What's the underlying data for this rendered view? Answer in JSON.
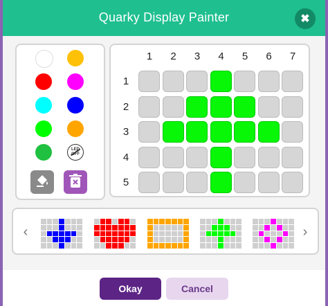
{
  "header": {
    "title": "Quarky Display Painter",
    "close_icon": "close-icon"
  },
  "palette": {
    "colors": [
      "#ffffff",
      "#ffc107",
      "#ff0000",
      "#ff00ff",
      "#00ffff",
      "#0000ff",
      "#00ff00",
      "#ffa500",
      "#20c040"
    ],
    "led_off_label": [
      "LED",
      "OFF"
    ],
    "tools": [
      {
        "icon": "fill-bucket-icon",
        "color": "#8a8a8a"
      },
      {
        "icon": "trash-icon",
        "color": "#a056b8"
      }
    ]
  },
  "grid": {
    "columns": [
      "1",
      "2",
      "3",
      "4",
      "5",
      "6",
      "7"
    ],
    "rows": [
      "1",
      "2",
      "3",
      "4",
      "5"
    ],
    "on_color": "#07f707",
    "off_color": "#d6d6d6",
    "cells": [
      [
        0,
        0,
        0,
        1,
        0,
        0,
        0
      ],
      [
        0,
        0,
        1,
        1,
        1,
        0,
        0
      ],
      [
        0,
        1,
        1,
        1,
        1,
        1,
        0
      ],
      [
        0,
        0,
        0,
        1,
        0,
        0,
        0
      ],
      [
        0,
        0,
        0,
        1,
        0,
        0,
        0
      ]
    ]
  },
  "presets": {
    "left_arrow": "‹",
    "right_arrow": "›",
    "items": [
      {
        "name": "blue-down-arrow",
        "color": "#0000ff",
        "cells": [
          [
            0,
            0,
            0,
            1,
            0,
            0,
            0
          ],
          [
            0,
            0,
            0,
            1,
            0,
            0,
            0
          ],
          [
            0,
            1,
            1,
            1,
            1,
            1,
            0
          ],
          [
            0,
            0,
            1,
            1,
            1,
            0,
            0
          ],
          [
            0,
            0,
            0,
            1,
            0,
            0,
            0
          ]
        ]
      },
      {
        "name": "red-heart",
        "color": "#ff0000",
        "cells": [
          [
            0,
            1,
            1,
            0,
            1,
            1,
            0
          ],
          [
            1,
            1,
            1,
            1,
            1,
            1,
            1
          ],
          [
            1,
            1,
            1,
            1,
            1,
            1,
            1
          ],
          [
            0,
            1,
            1,
            1,
            1,
            1,
            0
          ],
          [
            0,
            0,
            1,
            1,
            1,
            0,
            0
          ]
        ]
      },
      {
        "name": "orange-frame",
        "color": "#ffa500",
        "cells": [
          [
            1,
            1,
            1,
            1,
            1,
            1,
            1
          ],
          [
            1,
            0,
            0,
            0,
            0,
            0,
            1
          ],
          [
            1,
            0,
            0,
            0,
            0,
            0,
            1
          ],
          [
            1,
            0,
            0,
            0,
            0,
            0,
            1
          ],
          [
            1,
            1,
            1,
            1,
            1,
            1,
            1
          ]
        ]
      },
      {
        "name": "green-up-arrow",
        "color": "#00ff00",
        "cells": [
          [
            0,
            0,
            0,
            1,
            0,
            0,
            0
          ],
          [
            0,
            0,
            1,
            1,
            1,
            0,
            0
          ],
          [
            0,
            1,
            1,
            1,
            1,
            1,
            0
          ],
          [
            0,
            0,
            0,
            1,
            0,
            0,
            0
          ],
          [
            0,
            0,
            0,
            1,
            0,
            0,
            0
          ]
        ]
      },
      {
        "name": "magenta-diamond",
        "color": "#ff00ff",
        "cells": [
          [
            0,
            0,
            0,
            1,
            0,
            0,
            0
          ],
          [
            0,
            0,
            1,
            0,
            1,
            0,
            0
          ],
          [
            0,
            1,
            0,
            0,
            0,
            1,
            0
          ],
          [
            0,
            0,
            1,
            0,
            1,
            0,
            0
          ],
          [
            0,
            0,
            0,
            1,
            0,
            0,
            0
          ]
        ]
      }
    ]
  },
  "footer": {
    "ok_label": "Okay",
    "cancel_label": "Cancel"
  }
}
